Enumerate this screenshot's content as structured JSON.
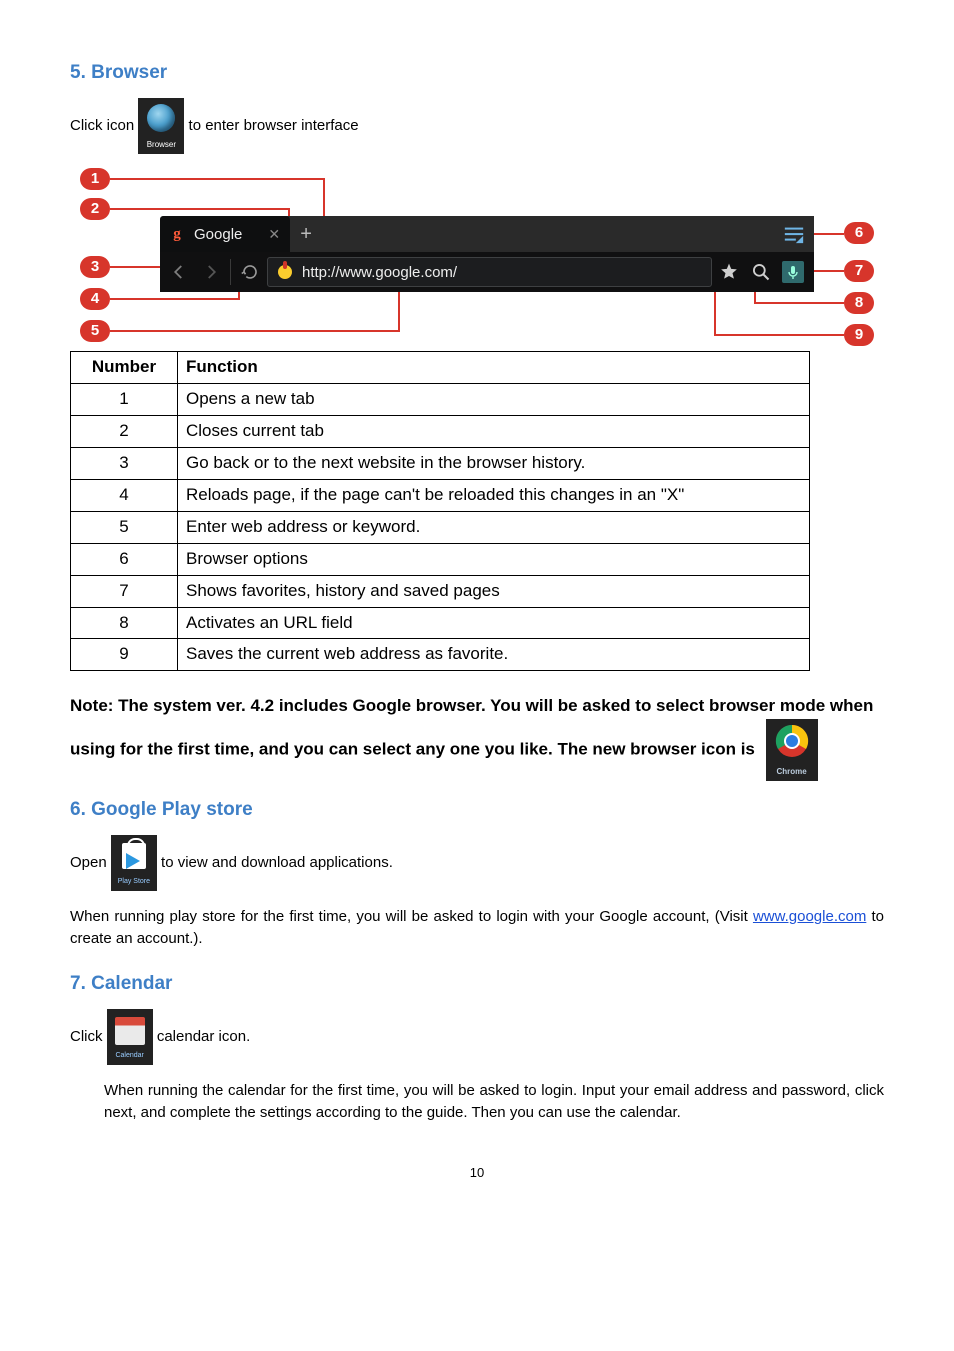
{
  "sections": {
    "browser_heading": "5. Browser",
    "play_heading": "6. Google Play store",
    "calendar_heading": "7. Calendar"
  },
  "intro": {
    "click_icon_pre": "Click icon ",
    "click_icon_post": " to enter browser interface",
    "browser_icon_label": "Browser"
  },
  "mock": {
    "tab_label": "Google",
    "url": "http://www.google.com/"
  },
  "badges": {
    "b1": "1",
    "b2": "2",
    "b3": "3",
    "b4": "4",
    "b5": "5",
    "b6": "6",
    "b7": "7",
    "b8": "8",
    "b9": "9"
  },
  "chart_data": {
    "type": "table",
    "columns": [
      "Number",
      "Function"
    ],
    "rows": [
      [
        "1",
        "Opens a new tab"
      ],
      [
        "2",
        "Closes current tab"
      ],
      [
        "3",
        "Go back or to the next website in the browser history."
      ],
      [
        "4",
        "Reloads page, if the page can't be reloaded this changes in an \"X\""
      ],
      [
        "5",
        "Enter web address or keyword."
      ],
      [
        "6",
        "Browser options"
      ],
      [
        "7",
        "Shows favorites, history and saved pages"
      ],
      [
        "8",
        "Activates an URL field"
      ],
      [
        "9",
        "Saves the current web address as favorite."
      ]
    ]
  },
  "note": {
    "text": "Note: The system ver. 4.2 includes Google browser. You will be asked to select browser mode when using for the first time, and you can select any one you like. The new browser icon is",
    "chrome_label": "Chrome"
  },
  "play": {
    "open_pre": "Open ",
    "open_post": " to view and download applications.",
    "icon_label": "Play Store",
    "para2_pre": "When running play store for the first time, you will be asked to login with your Google account, (Visit ",
    "link_text": "www.google.com",
    "para2_post": " to create an account.)."
  },
  "calendar": {
    "click_pre": "Click ",
    "click_post": " calendar icon.",
    "icon_label": "Calendar",
    "para": "When running the calendar for the first time, you will be asked to login. Input your email address and password, click next, and complete the settings according to the guide. Then you can use the calendar."
  },
  "page_number": "10"
}
